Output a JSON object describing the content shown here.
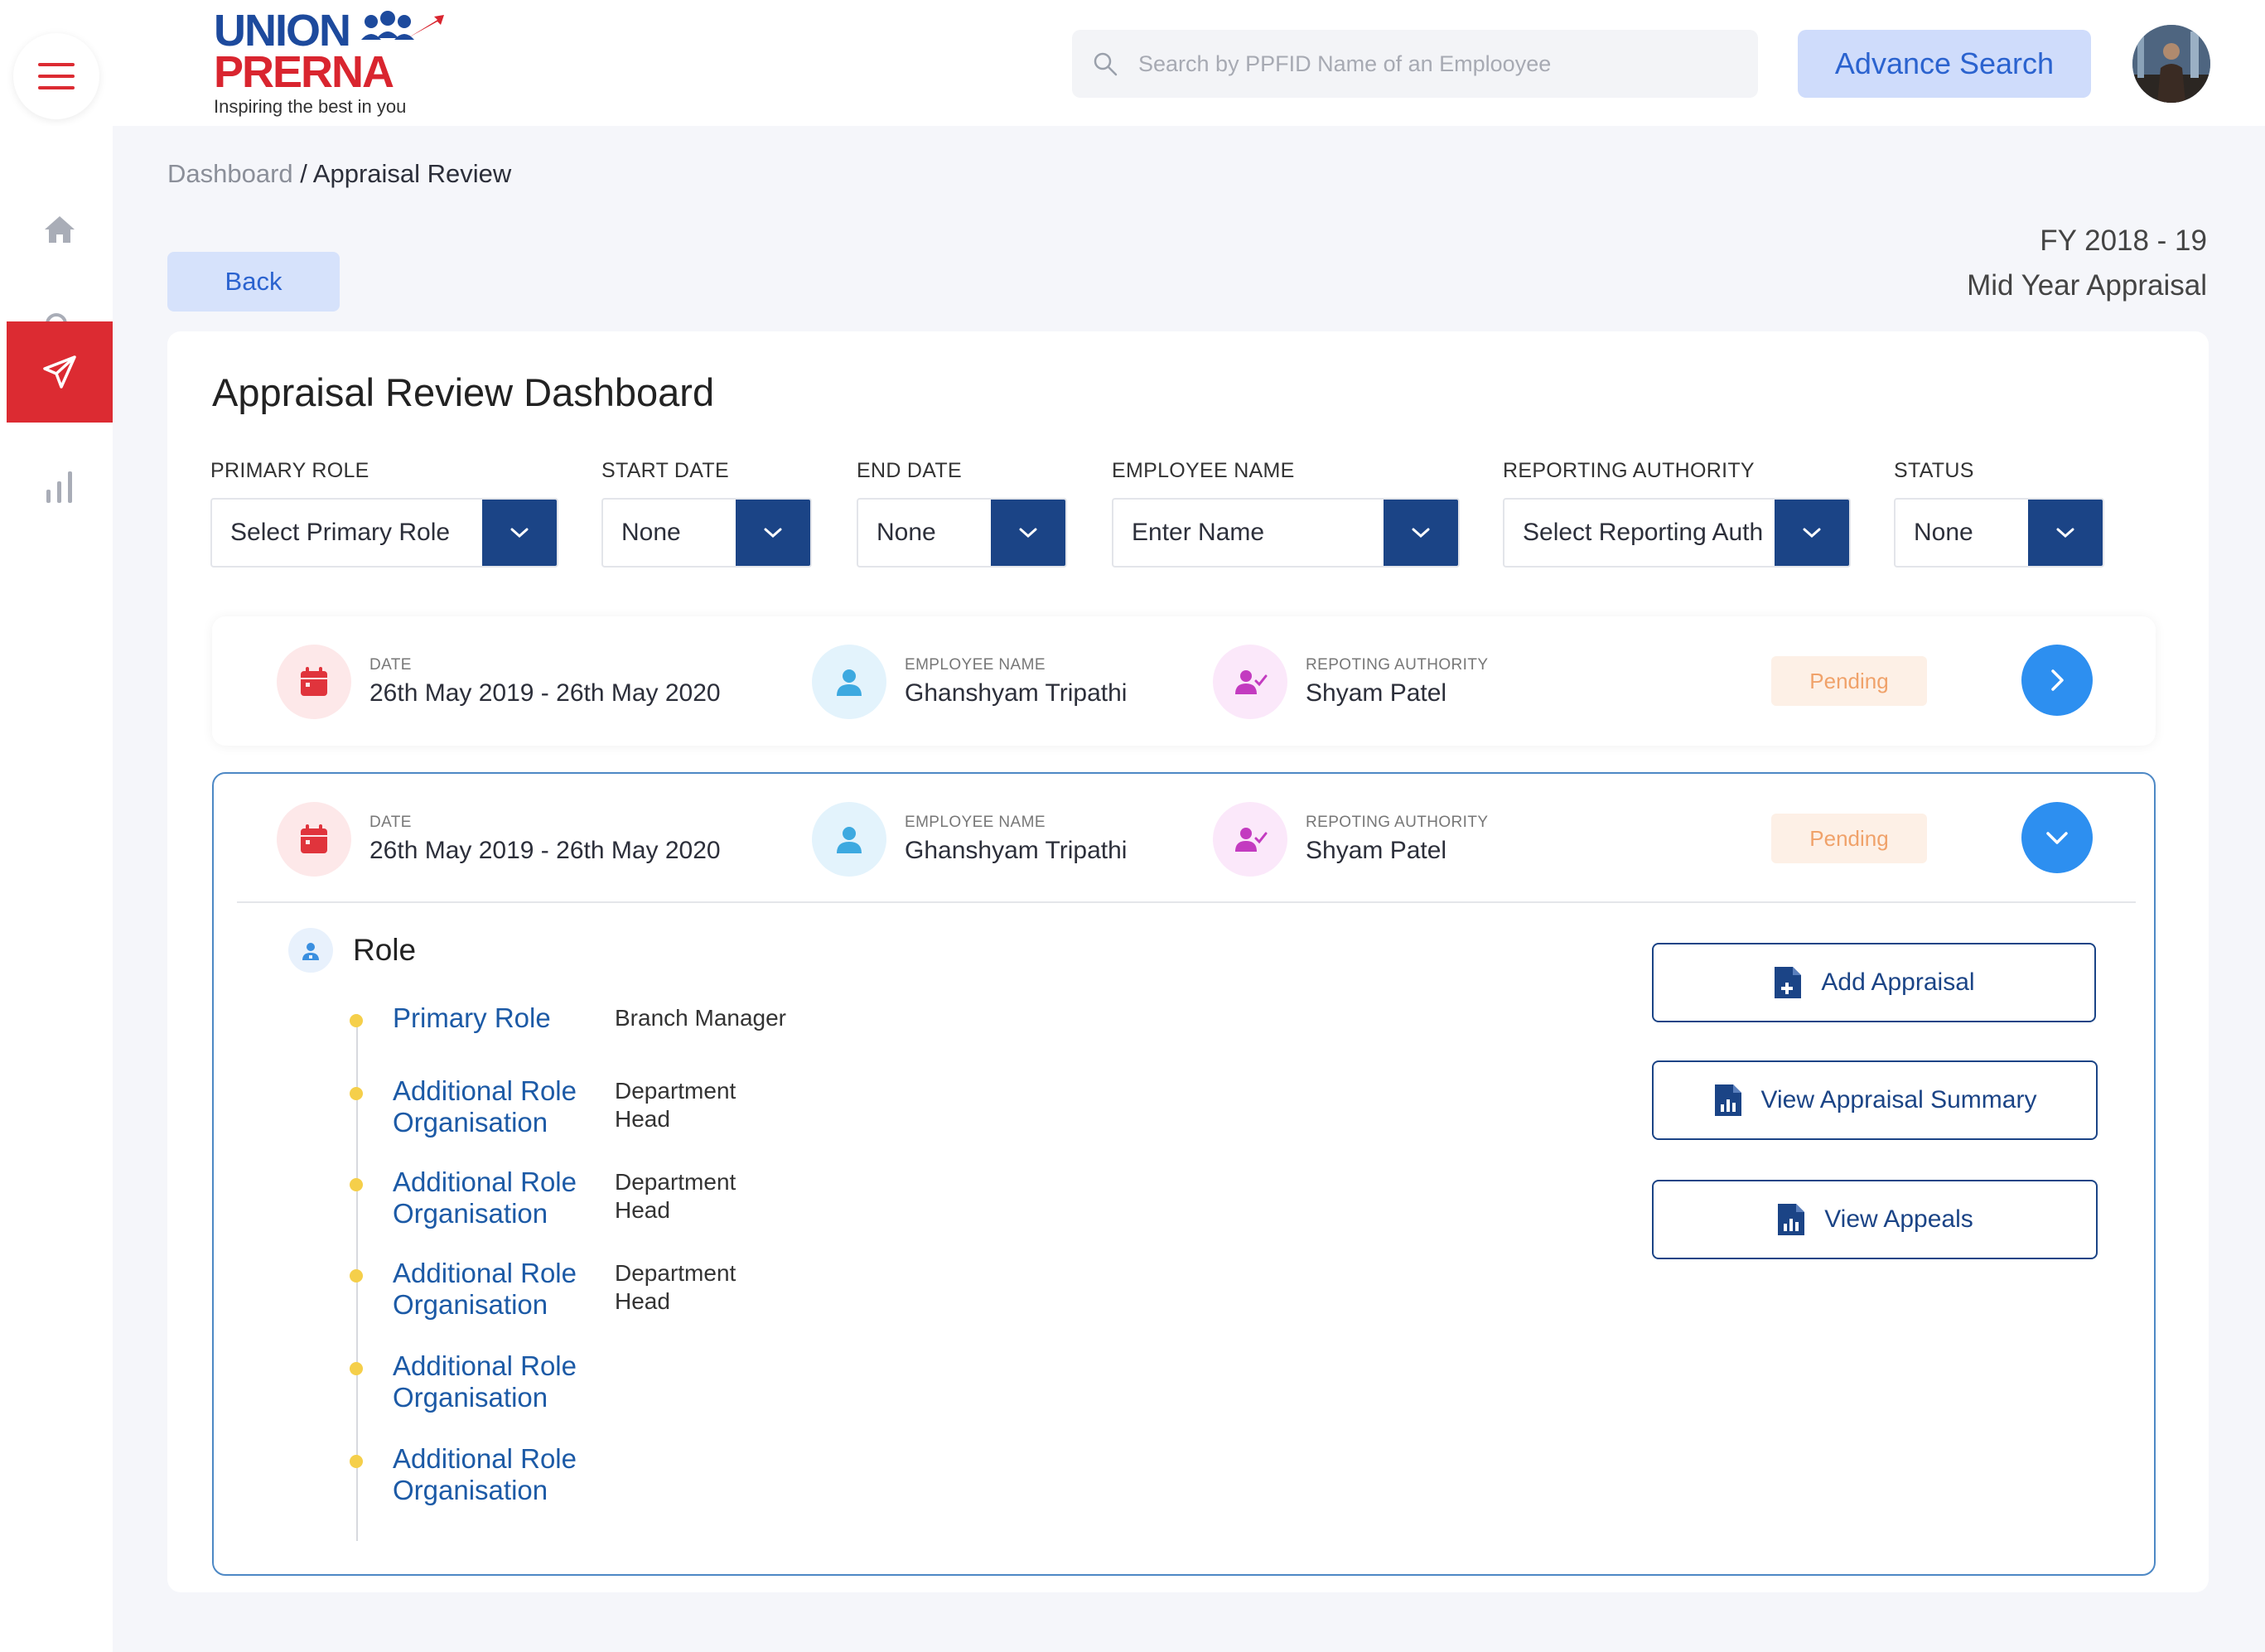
{
  "header": {
    "logo_line1": "UNION",
    "logo_line2": "PRERNA",
    "logo_tagline": "Inspiring the best in you",
    "search_placeholder": "Search by PPFID Name of an Emplooyee",
    "advance_search_label": "Advance Search"
  },
  "sidebar": {
    "items": [
      {
        "name": "home",
        "icon": "home-icon",
        "active": false
      },
      {
        "name": "search",
        "icon": "search-icon",
        "active": false
      },
      {
        "name": "appraisal",
        "icon": "send-icon",
        "active": true
      },
      {
        "name": "reports",
        "icon": "bar-chart-icon",
        "active": false
      }
    ],
    "active_color": "#dc2b32"
  },
  "breadcrumb": {
    "root": "Dashboard",
    "current": "/ Appraisal Review"
  },
  "back_label": "Back",
  "fiscal": {
    "year": "FY 2018 - 19",
    "cycle": "Mid Year Appraisal"
  },
  "dashboard": {
    "title": "Appraisal Review Dashboard",
    "filters": [
      {
        "label": "PRIMARY ROLE",
        "value": "Select Primary Role"
      },
      {
        "label": "START DATE",
        "value": "None"
      },
      {
        "label": "END DATE",
        "value": "None"
      },
      {
        "label": "EMPLOYEE NAME",
        "value": "Enter Name"
      },
      {
        "label": "REPORTING AUTHORITY",
        "value": "Select Reporting Auth"
      },
      {
        "label": "STATUS",
        "value": "None"
      }
    ],
    "records": [
      {
        "date_label": "DATE",
        "date": "26th May 2019 - 26th May 2020",
        "employee_label": "EMPLOYEE NAME",
        "employee": "Ghanshyam Tripathi",
        "authority_label": "REPOTING AUTHORITY",
        "authority": "Shyam Patel",
        "status": "Pending",
        "expanded": false
      },
      {
        "date_label": "DATE",
        "date": "26th May 2019 - 26th May 2020",
        "employee_label": "EMPLOYEE NAME",
        "employee": "Ghanshyam Tripathi",
        "authority_label": "REPOTING AUTHORITY",
        "authority": "Shyam Patel",
        "status": "Pending",
        "expanded": true,
        "role_title": "Role",
        "roles": [
          {
            "key": "Primary Role",
            "value": "Branch Manager"
          },
          {
            "key": "Additional Role Organisation",
            "value": "Department Head"
          },
          {
            "key": "Additional Role Organisation",
            "value": "Department Head"
          },
          {
            "key": "Additional Role Organisation",
            "value": "Department Head"
          },
          {
            "key": "Additional Role Organisation",
            "value": ""
          },
          {
            "key": "Additional Role Organisation",
            "value": ""
          }
        ],
        "actions": [
          "Add Appraisal",
          "View  Appraisal Summary",
          "View  Appeals"
        ]
      }
    ]
  },
  "colors": {
    "primary_dark": "#1b4486",
    "accent_blue": "#2d8ff0",
    "pending_text": "#f0a26a",
    "pending_bg": "#fdf0e6",
    "timeline_dot": "#f5cf4a"
  }
}
